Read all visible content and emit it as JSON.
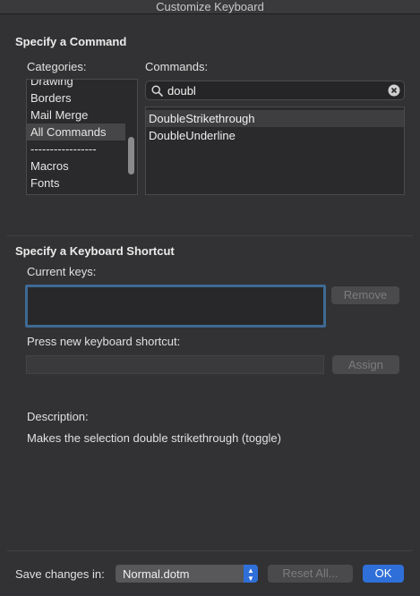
{
  "window": {
    "title": "Customize Keyboard"
  },
  "command_section": {
    "title": "Specify a Command",
    "categories_label": "Categories:",
    "commands_label": "Commands:",
    "categories": [
      "Drawing",
      "Borders",
      "Mail Merge",
      "All Commands",
      "-----------------",
      "Macros",
      "Fonts"
    ],
    "selected_category": "All Commands",
    "search_value": "doubl",
    "commands": [
      "DoubleStrikethrough",
      "DoubleUnderline"
    ],
    "selected_command": "DoubleStrikethrough"
  },
  "shortcut_section": {
    "title": "Specify a Keyboard Shortcut",
    "current_keys_label": "Current keys:",
    "remove_label": "Remove",
    "new_shortcut_label": "Press new keyboard shortcut:",
    "assign_label": "Assign",
    "description_label": "Description:",
    "description_text": "Makes the selection double strikethrough (toggle)"
  },
  "footer": {
    "save_in_label": "Save changes in:",
    "save_in_value": "Normal.dotm",
    "reset_label": "Reset All...",
    "ok_label": "OK"
  },
  "colors": {
    "accent": "#2f6fd9",
    "focus_ring": "#3d6a93"
  }
}
